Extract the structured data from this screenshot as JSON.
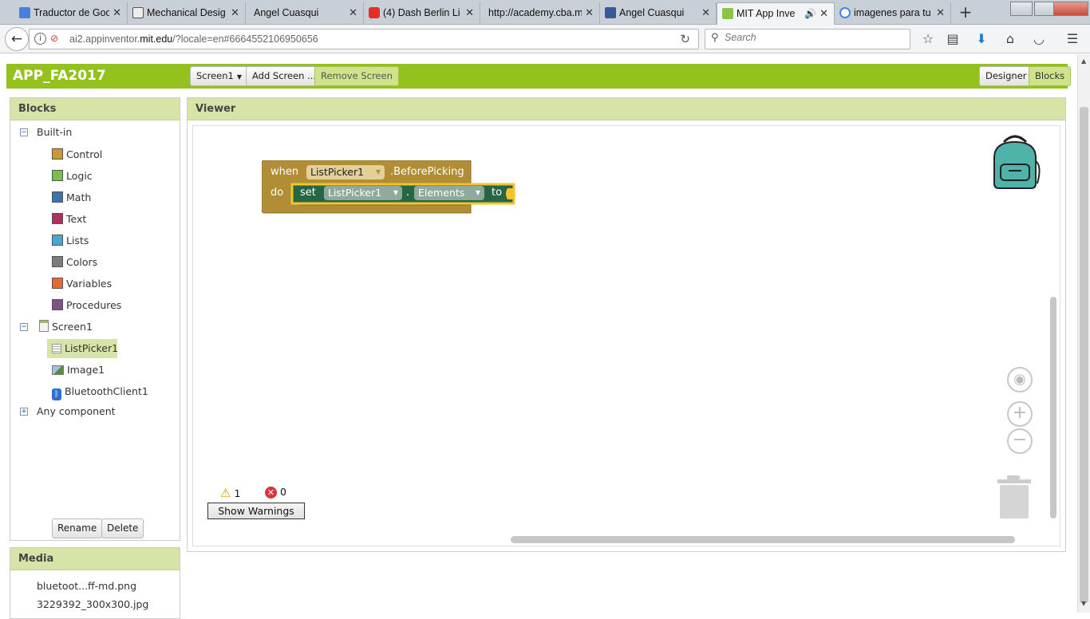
{
  "browser": {
    "tabs": [
      {
        "label": "Traductor de Goo",
        "fav_color": "#4a7fe0"
      },
      {
        "label": "Mechanical Desig",
        "fav_color": "#555555"
      },
      {
        "label": "Angel Cuasqui",
        "fav_color": ""
      },
      {
        "label": "(4) Dash Berlin Li",
        "fav_color": "#e52d27"
      },
      {
        "label": "http://academy.cba.m",
        "fav_color": ""
      },
      {
        "label": "Angel Cuasqui",
        "fav_color": "#3b5998"
      },
      {
        "label": "MIT App Inve",
        "fav_color": "#8bc34a"
      },
      {
        "label": "imagenes para tu",
        "fav_color": "#4285f4"
      }
    ],
    "active_tab": 6,
    "url_prefix": "ai2.appinventor.",
    "url_host": "mit.edu",
    "url_rest": "/?locale=en#6664552106950656",
    "search_placeholder": "Search"
  },
  "app": {
    "title": "APP_FA2017",
    "screen_selector": "Screen1",
    "add_screen": "Add Screen ...",
    "remove_screen": "Remove Screen",
    "designer": "Designer",
    "blocks_btn": "Blocks",
    "accent": "#95c11f"
  },
  "blocks_panel": {
    "heading": "Blocks",
    "builtin": "Built-in",
    "builtin_items": [
      {
        "label": "Control",
        "color": "#c99a2e"
      },
      {
        "label": "Logic",
        "color": "#7bbf4a"
      },
      {
        "label": "Math",
        "color": "#3f71b5"
      },
      {
        "label": "Text",
        "color": "#b32d5e"
      },
      {
        "label": "Lists",
        "color": "#49a6d4"
      },
      {
        "label": "Colors",
        "color": "#7d7d7d"
      },
      {
        "label": "Variables",
        "color": "#e16b35"
      },
      {
        "label": "Procedures",
        "color": "#7c5385"
      }
    ],
    "screen": "Screen1",
    "components": [
      "ListPicker1",
      "Image1",
      "BluetoothClient1"
    ],
    "any_component": "Any component",
    "rename": "Rename",
    "delete": "Delete"
  },
  "media_panel": {
    "heading": "Media",
    "items": [
      "bluetoot...ff-md.png",
      "3229392_300x300.jpg"
    ]
  },
  "viewer": {
    "heading": "Viewer",
    "event_block": {
      "when": "when",
      "component": "ListPicker1",
      "event": ".BeforePicking",
      "do": "do",
      "color": "#b18e35"
    },
    "setter_block": {
      "set": "set",
      "component": "ListPicker1",
      "dot": ".",
      "property": "Elements",
      "to": "to",
      "color": "#266643",
      "highlight": "#f4c430"
    },
    "warnings_count": "1",
    "errors_count": "0",
    "show_warnings": "Show Warnings"
  }
}
